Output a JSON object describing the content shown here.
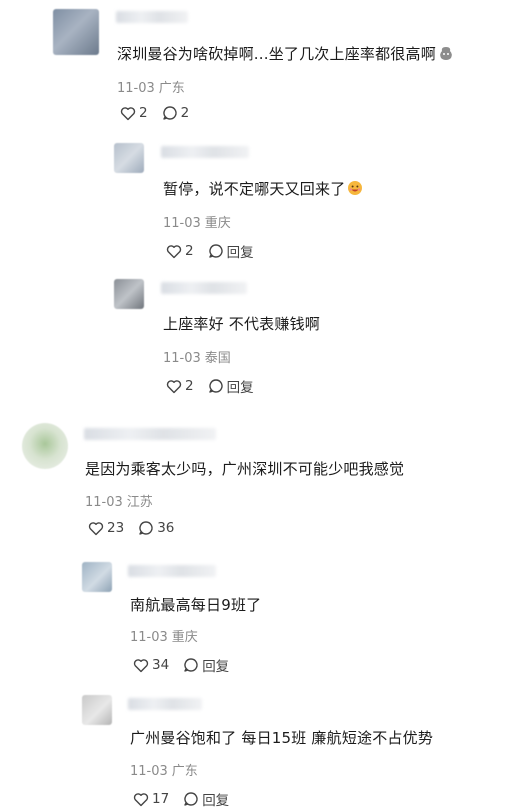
{
  "comments": [
    {
      "text": "深圳曼谷为啥砍掉啊...坐了几次上座率都很高啊",
      "emoji": "sweat-bag-emoji",
      "date": "11-03",
      "location": "广东",
      "likes": "2",
      "replies": "2",
      "replies_list": [
        {
          "text": "暂停，说不定哪天又回来了",
          "emoji": "grin-emoji",
          "date": "11-03",
          "location": "重庆",
          "likes": "2",
          "reply_label": "回复"
        },
        {
          "text": "上座率好 不代表赚钱啊",
          "date": "11-03",
          "location": "泰国",
          "likes": "2",
          "reply_label": "回复"
        }
      ]
    },
    {
      "text": "是因为乘客太少吗，广州深圳不可能少吧我感觉",
      "date": "11-03",
      "location": "江苏",
      "likes": "23",
      "replies": "36",
      "replies_list": [
        {
          "text": "南航最高每日9班了",
          "date": "11-03",
          "location": "重庆",
          "likes": "34",
          "reply_label": "回复"
        },
        {
          "text": "广州曼谷饱和了 每日15班 廉航短途不占优势",
          "date": "11-03",
          "location": "广东",
          "likes": "17",
          "reply_label": "回复"
        }
      ]
    }
  ],
  "colors": {
    "text": "#1b1b1b",
    "meta": "#8a8a8a",
    "icon": "#444444"
  }
}
